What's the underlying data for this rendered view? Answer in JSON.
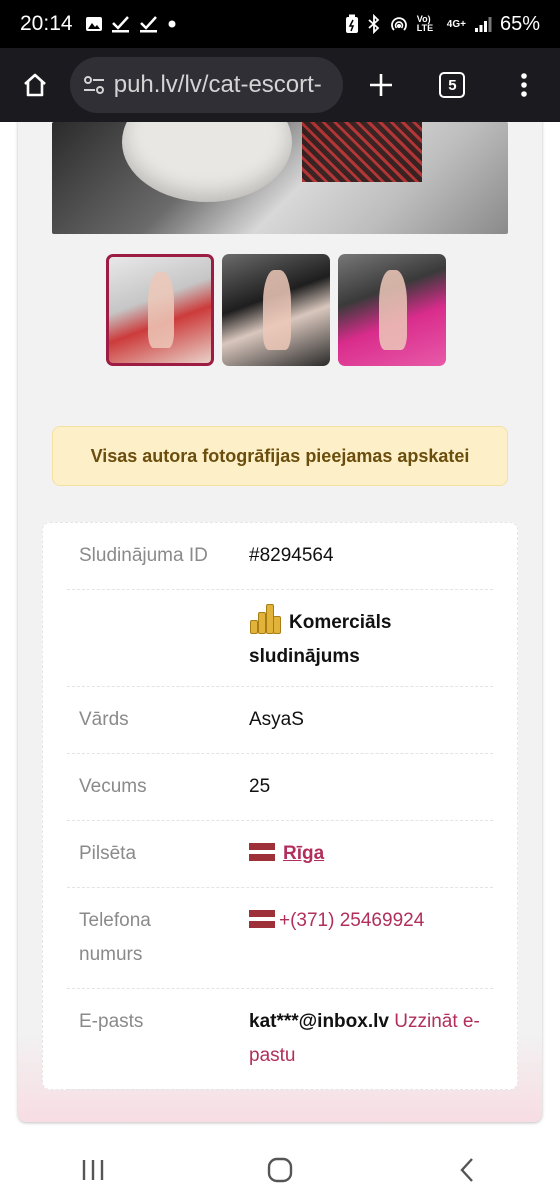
{
  "status_bar": {
    "time": "20:14",
    "network": "4G+",
    "battery": "65%",
    "volte": "Vo) LTE"
  },
  "browser": {
    "url": "puh.lv/lv/cat-escort-",
    "tab_count": "5"
  },
  "gallery": {
    "selected_index": 0,
    "thumbnail_count": 3
  },
  "notice": {
    "text": "Visas autora fotogrāfijas pieejamas apskatei"
  },
  "details": {
    "id_label": "Sludinājuma ID",
    "id_value": "#8294564",
    "commercial_line1": "Komerciāls",
    "commercial_line2": "sludinājums",
    "name_label": "Vārds",
    "name_value": "AsyaS",
    "age_label": "Vecums",
    "age_value": "25",
    "city_label": "Pilsēta",
    "city_value": "Rīga",
    "phone_label_line1": "Telefona",
    "phone_label_line2": "numurs",
    "phone_value": "+(371) 25469924",
    "email_label": "E-pasts",
    "email_value": "kat***@inbox.lv",
    "email_link_line1": "Uzzināt e-",
    "email_link_line2": "pastu"
  },
  "colors": {
    "accent": "#b12f5a",
    "notice_bg": "#fdf0c9",
    "notice_text": "#6b4e0d",
    "flag_red": "#9e3039"
  }
}
